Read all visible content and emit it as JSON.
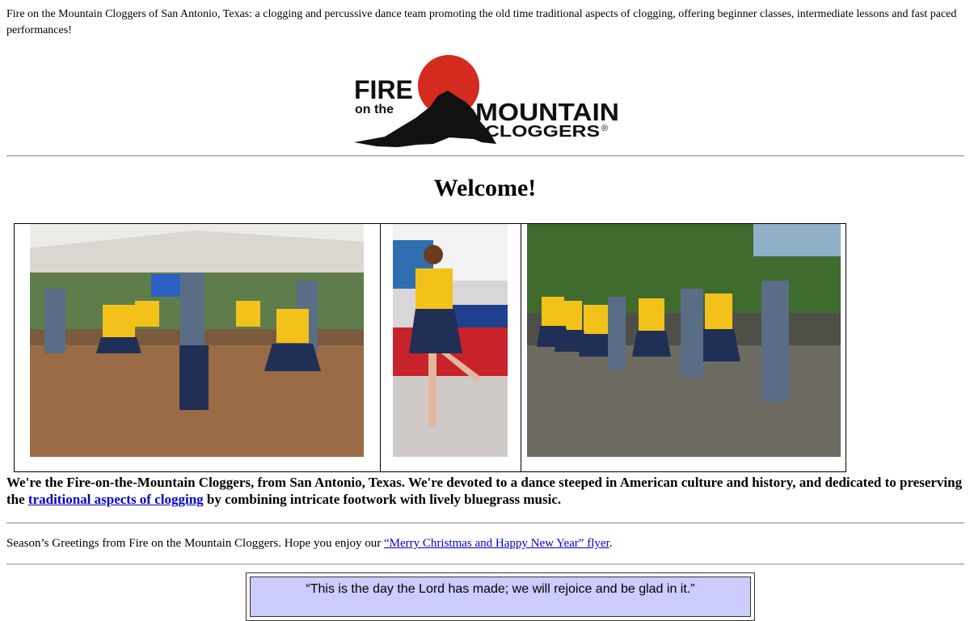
{
  "intro_text": "Fire on the Mountain Cloggers of San Antonio, Texas:  a clogging and percussive dance team promoting the old time traditional aspects of clogging, offering beginner classes, intermediate lessons and fast paced performances!",
  "logo": {
    "word_fire": "FIRE",
    "word_on_the": "on the",
    "word_mountain": "MOUNTAIN",
    "word_cloggers": "CLOGGERS",
    "registered_mark": "®",
    "sun_color": "#d42b1e"
  },
  "welcome": "Welcome!",
  "photos": [
    {
      "name": "dancers-under-tent-photo"
    },
    {
      "name": "solo-dancer-photo"
    },
    {
      "name": "group-outdoor-performance-photo"
    }
  ],
  "about": {
    "text_before": "We're the Fire-on-the-Mountain Cloggers, from San Antonio, Texas. We're devoted to a dance steeped in American culture and history, and dedicated to preserving the ",
    "link_text": "traditional aspects of clogging",
    "text_after": " by combining intricate footwork with lively bluegrass music."
  },
  "greeting": {
    "text_before": "Season’s Greetings from Fire on the Mountain Cloggers. Hope you enjoy our ",
    "link_text": "“Merry Christmas and Happy New Year” flyer",
    "text_after": "."
  },
  "quote": "“This is the day the Lord has made; we will rejoice and be glad in it.”",
  "colors": {
    "link": "#0000cc",
    "quote_box": "#ccccff",
    "shirt_yellow": "#f2c21b",
    "skirt_navy": "#1f2f55"
  }
}
